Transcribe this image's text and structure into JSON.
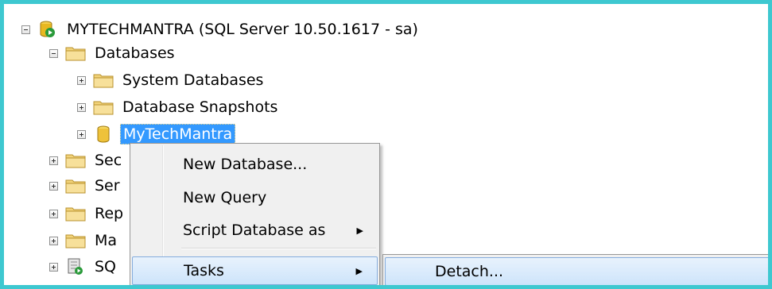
{
  "tree": {
    "server": "MYTECHMANTRA (SQL Server 10.50.1617 - sa)",
    "databases": "Databases",
    "system_databases": "System Databases",
    "database_snapshots": "Database Snapshots",
    "user_database": "MyTechMantra",
    "security": "Sec",
    "server_objects": "Ser",
    "replication": "Rep",
    "management": "Ma",
    "sql_agent": "SQ"
  },
  "context_menu": {
    "items": [
      "New Database...",
      "New Query",
      "Script Database as",
      "Tasks"
    ]
  },
  "submenu": {
    "items": [
      "Detach..."
    ]
  },
  "colors": {
    "selection": "#3399ff",
    "frame": "#3ec8d0",
    "highlight_border": "#84acdd"
  }
}
